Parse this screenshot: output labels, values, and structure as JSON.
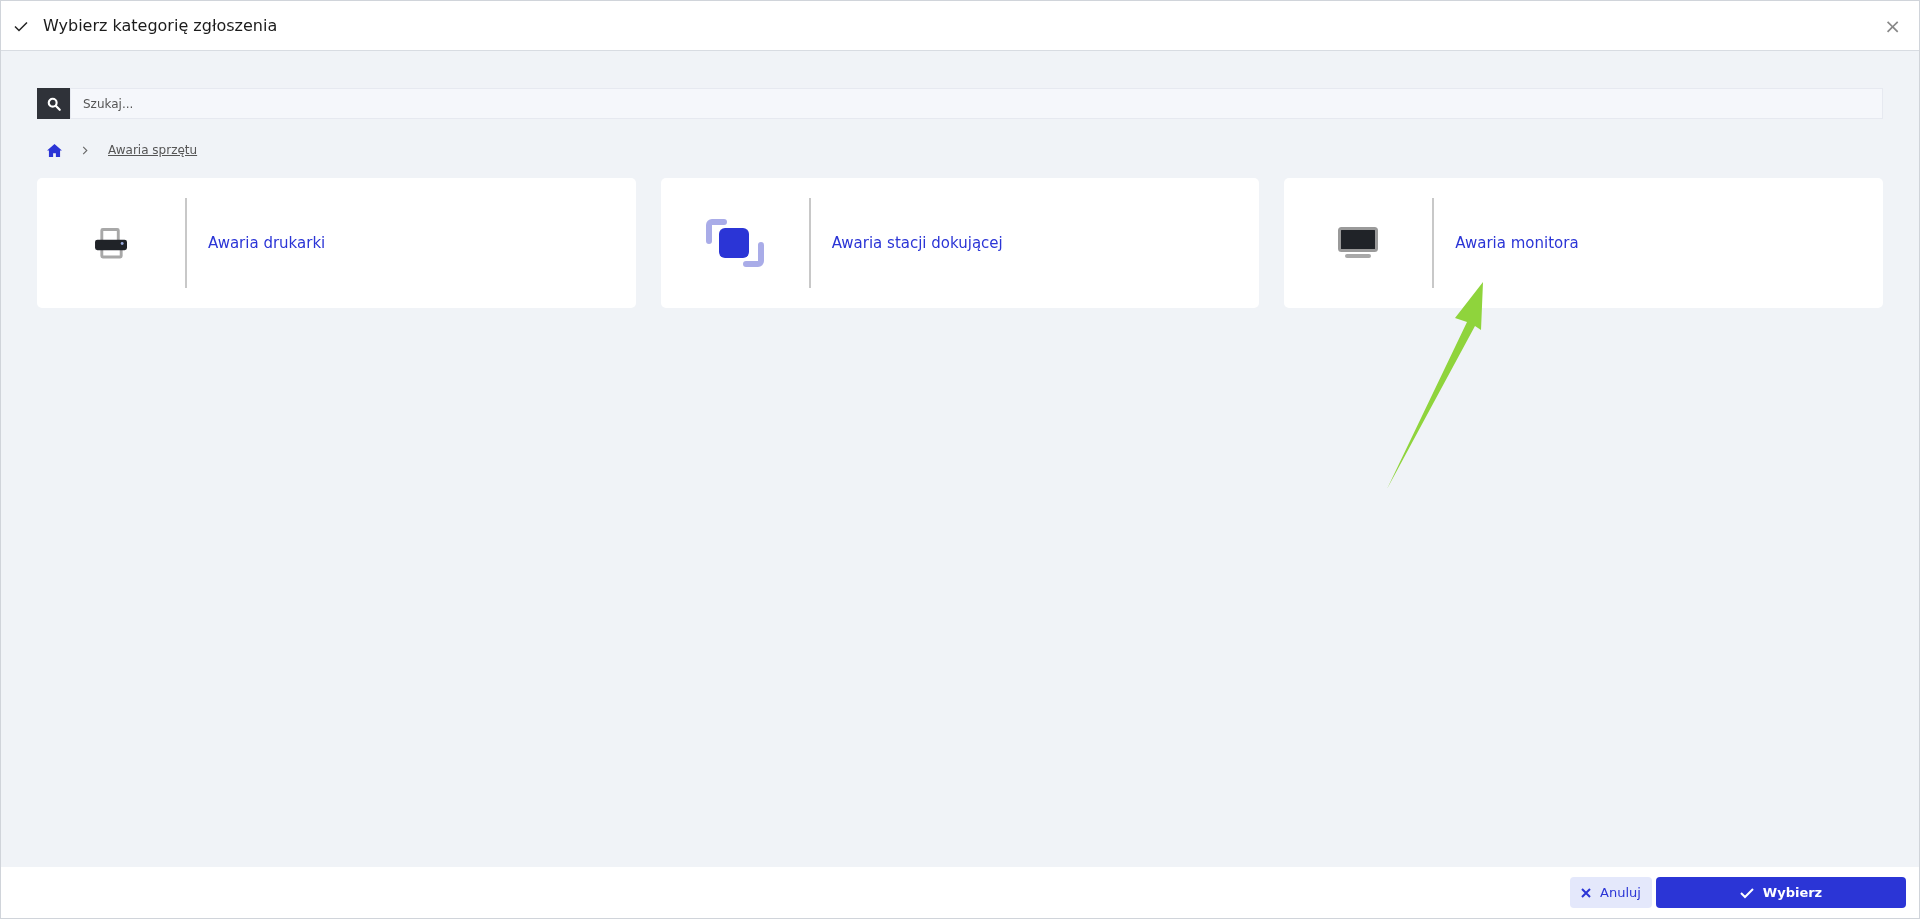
{
  "window": {
    "title": "Wybierz kategorię zgłoszenia",
    "close": "×"
  },
  "search": {
    "placeholder": "Szukaj..."
  },
  "breadcrumb": [
    {
      "label": "Awaria sprzętu"
    }
  ],
  "categories": [
    {
      "kind": "printer",
      "label": "Awaria drukarki"
    },
    {
      "kind": "dock",
      "label": "Awaria stacji dokującej"
    },
    {
      "kind": "monitor",
      "label": "Awaria monitora"
    }
  ],
  "buttons": [
    {
      "kind": "cancel",
      "label": "Anuluj"
    },
    {
      "kind": "confirm",
      "label": "Wybierz"
    }
  ]
}
